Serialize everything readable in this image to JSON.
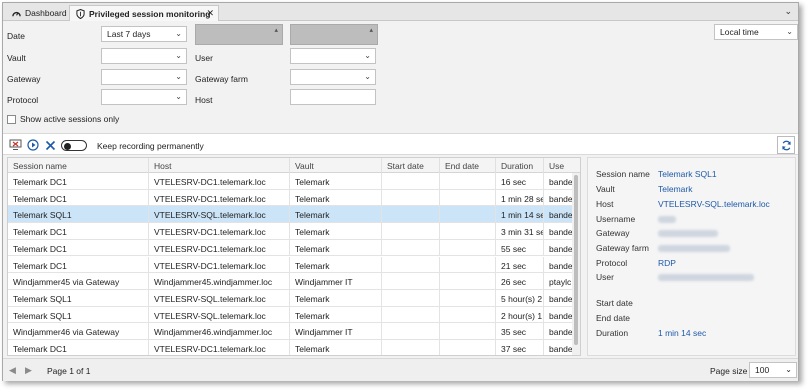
{
  "tabs": [
    {
      "label": "Dashboard",
      "icon": "dashboard-icon"
    },
    {
      "label": "Privileged session monitoring",
      "icon": "shield-icon",
      "close": "✕"
    }
  ],
  "filters": {
    "date_label": "Date",
    "date_value": "Last 7 days",
    "vault_label": "Vault",
    "user_label": "User",
    "gateway_label": "Gateway",
    "gateway_farm_label": "Gateway farm",
    "protocol_label": "Protocol",
    "host_label": "Host",
    "show_active_label": "Show active sessions only",
    "timezone_value": "Local time"
  },
  "toolbar": {
    "keep_recording_label": "Keep recording permanently"
  },
  "grid": {
    "columns": [
      "Session name",
      "Host",
      "Vault",
      "Start date",
      "End date",
      "Duration",
      "Use"
    ],
    "rows": [
      [
        "Telemark DC1",
        "VTELESRV-DC1.telemark.loc",
        "Telemark",
        "",
        "",
        "16 sec",
        "bande"
      ],
      [
        "Telemark DC1",
        "VTELESRV-DC1.telemark.loc",
        "Telemark",
        "",
        "",
        "1 min 28 se",
        "bande"
      ],
      [
        "Telemark SQL1",
        "VTELESRV-SQL.telemark.loc",
        "Telemark",
        "",
        "",
        "1 min 14 se",
        "bande"
      ],
      [
        "Telemark DC1",
        "VTELESRV-DC1.telemark.loc",
        "Telemark",
        "",
        "",
        "3 min 31 se",
        "bande"
      ],
      [
        "Telemark DC1",
        "VTELESRV-DC1.telemark.loc",
        "Telemark",
        "",
        "",
        "55 sec",
        "bande"
      ],
      [
        "Telemark DC1",
        "VTELESRV-DC1.telemark.loc",
        "Telemark",
        "",
        "",
        "21 sec",
        "bande"
      ],
      [
        "Windjammer45 via Gateway",
        "Windjammer45.windjammer.loc",
        "Windjammer IT",
        "",
        "",
        "26 sec",
        "ptaylc"
      ],
      [
        "Telemark SQL1",
        "VTELESRV-SQL.telemark.loc",
        "Telemark",
        "",
        "",
        "5 hour(s) 2",
        "bande"
      ],
      [
        "Telemark SQL1",
        "VTELESRV-SQL.telemark.loc",
        "Telemark",
        "",
        "",
        "2 hour(s) 1",
        "bande"
      ],
      [
        "Windjammer46 via Gateway",
        "Windjammer46.windjammer.loc",
        "Windjammer IT",
        "",
        "",
        "35 sec",
        "bande"
      ],
      [
        "Telemark DC1",
        "VTELESRV-DC1.telemark.loc",
        "Telemark",
        "",
        "",
        "37 sec",
        "bande"
      ]
    ]
  },
  "detail": {
    "session_name_label": "Session name",
    "session_name": "Telemark SQL1",
    "vault_label": "Vault",
    "vault": "Telemark",
    "host_label": "Host",
    "host": "VTELESRV-SQL.telemark.loc",
    "username_label": "Username",
    "gateway_label": "Gateway",
    "gateway_farm_label": "Gateway farm",
    "protocol_label": "Protocol",
    "protocol": "RDP",
    "user_label": "User",
    "start_date_label": "Start date",
    "end_date_label": "End date",
    "duration_label": "Duration",
    "duration": "1 min 14 sec"
  },
  "footer": {
    "page_label": "Page 1 of 1",
    "page_size_label": "Page size",
    "page_size_value": "100"
  },
  "colors": {
    "accent": "#1e5aa8",
    "selected_row": "#cce4f7",
    "stop_red": "#c0392b"
  }
}
